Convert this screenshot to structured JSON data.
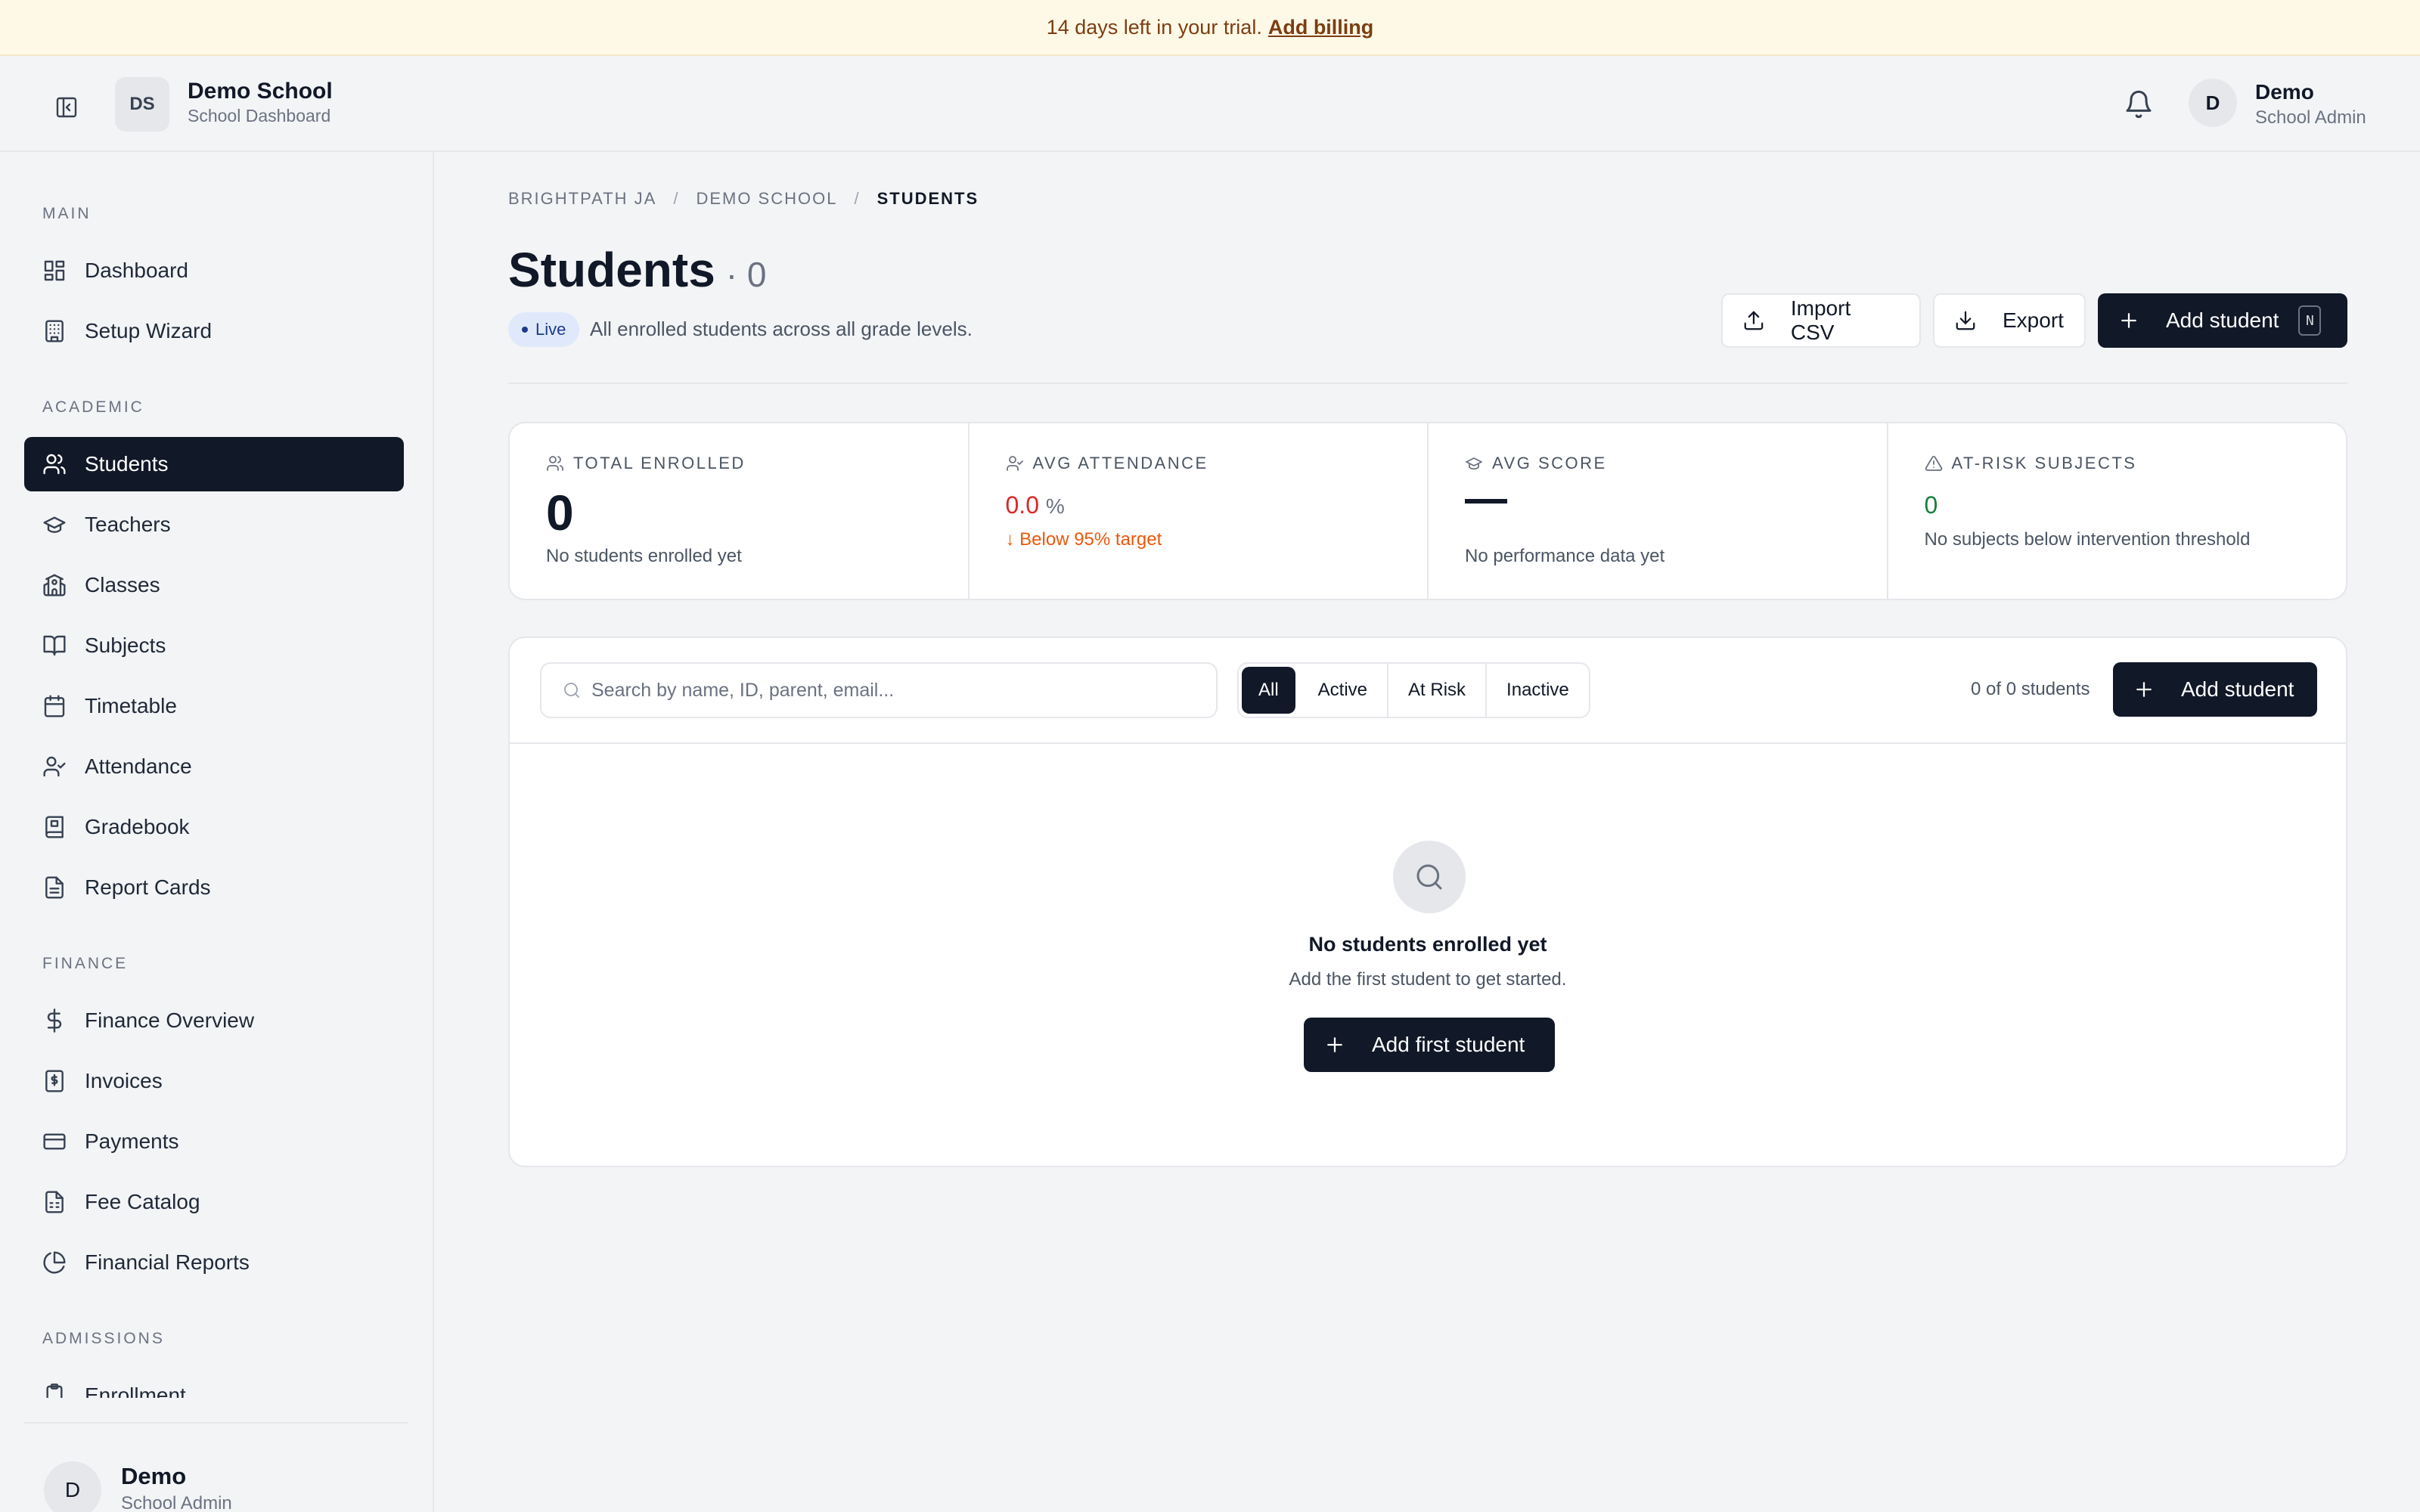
{
  "banner": {
    "text": "14 days left in your trial.",
    "link": "Add billing"
  },
  "header": {
    "school_initials": "DS",
    "school_name": "Demo School",
    "school_subtitle": "School Dashboard",
    "user_initial": "D",
    "user_name": "Demo",
    "user_role": "School Admin"
  },
  "sidebar": {
    "sections": {
      "main": "MAIN",
      "academic": "ACADEMIC",
      "finance": "FINANCE",
      "admissions": "ADMISSIONS"
    },
    "items": [
      {
        "label": "Dashboard",
        "icon": "dashboard-icon"
      },
      {
        "label": "Setup Wizard",
        "icon": "building-icon"
      },
      {
        "label": "Students",
        "icon": "users-icon",
        "active": true
      },
      {
        "label": "Teachers",
        "icon": "graduation-cap-icon"
      },
      {
        "label": "Classes",
        "icon": "school-icon"
      },
      {
        "label": "Subjects",
        "icon": "book-icon"
      },
      {
        "label": "Timetable",
        "icon": "calendar-icon"
      },
      {
        "label": "Attendance",
        "icon": "user-check-icon"
      },
      {
        "label": "Gradebook",
        "icon": "gradebook-icon"
      },
      {
        "label": "Report Cards",
        "icon": "file-text-icon"
      },
      {
        "label": "Finance Overview",
        "icon": "dollar-icon"
      },
      {
        "label": "Invoices",
        "icon": "receipt-icon"
      },
      {
        "label": "Payments",
        "icon": "credit-card-icon"
      },
      {
        "label": "Fee Catalog",
        "icon": "fee-catalog-icon"
      },
      {
        "label": "Financial Reports",
        "icon": "pie-chart-icon"
      },
      {
        "label": "Enrollment",
        "icon": "clipboard-icon"
      }
    ],
    "footer": {
      "initial": "D",
      "name": "Demo",
      "role": "School Admin"
    }
  },
  "breadcrumb": [
    "BRIGHTPATH JA",
    "DEMO SCHOOL",
    "STUDENTS"
  ],
  "page": {
    "title": "Students",
    "count": "· 0",
    "badge": "Live",
    "description": "All enrolled students across all grade levels."
  },
  "actions": {
    "import": "Import CSV",
    "export": "Export",
    "add": "Add student",
    "add_shortcut": "N"
  },
  "stats": {
    "total_label": "TOTAL ENROLLED",
    "total_value": "0",
    "total_sub": "No students enrolled yet",
    "attendance_label": "AVG ATTENDANCE",
    "attendance_value": "0.0",
    "attendance_unit": "%",
    "attendance_sub": "↓ Below 95% target",
    "score_label": "AVG SCORE",
    "score_sub": "No performance data yet",
    "risk_label": "AT-RISK SUBJECTS",
    "risk_value": "0",
    "risk_sub": "No subjects below intervention threshold"
  },
  "table": {
    "search_placeholder": "Search by name, ID, parent, email...",
    "filters": [
      "All",
      "Active",
      "At Risk",
      "Inactive"
    ],
    "selected_filter": "All",
    "count_text": "0 of 0 students",
    "add_label": "Add student"
  },
  "empty": {
    "title": "No students enrolled yet",
    "subtitle": "Add the first student to get started.",
    "button": "Add first student"
  },
  "colors": {
    "primary": "#111827",
    "danger": "#dc2626",
    "warning": "#ea580c",
    "success": "#15803d",
    "banner_bg": "#fef9e7"
  }
}
